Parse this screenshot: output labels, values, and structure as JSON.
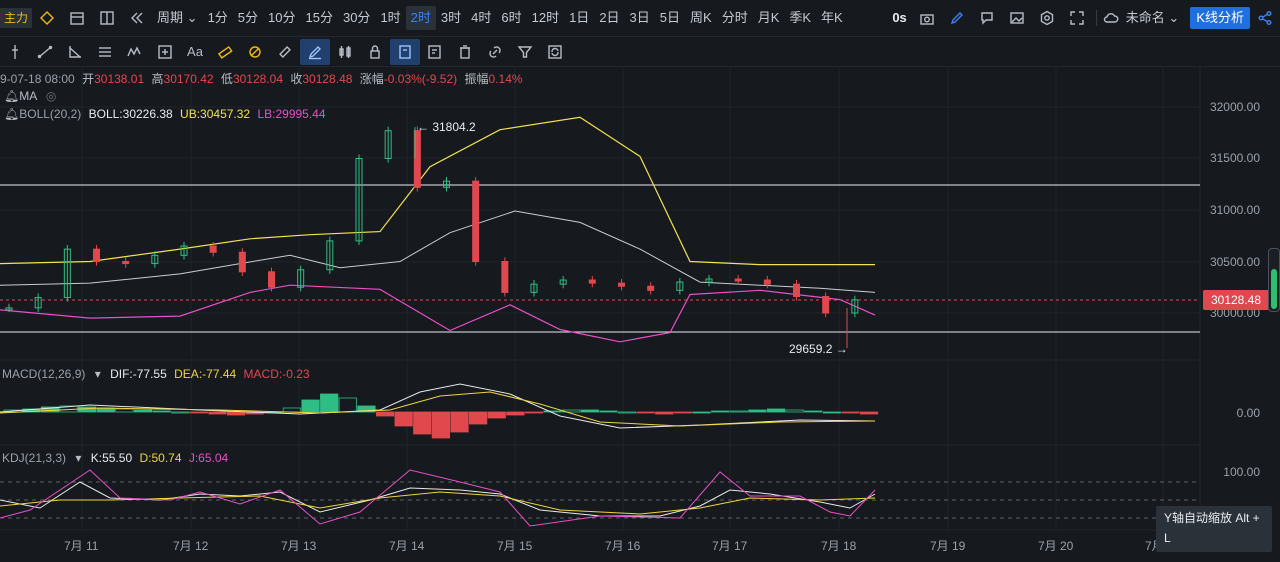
{
  "topbar": {
    "main_label": "主力",
    "period_label": "周期",
    "intervals": [
      "1分",
      "5分",
      "10分",
      "15分",
      "30分",
      "1时",
      "2时",
      "3时",
      "4时",
      "6时",
      "12时",
      "1日",
      "2日",
      "3日",
      "5日",
      "周K",
      "分时",
      "月K",
      "季K",
      "年K"
    ],
    "active_interval": "2时",
    "countdown": "0s",
    "account_name": "未命名",
    "analysis_button": "K线分析"
  },
  "ohlc": {
    "date": "9-07-18 08:00",
    "open_label": "开",
    "open": "30138.01",
    "high_label": "高",
    "high": "30170.42",
    "low_label": "低",
    "low": "30128.04",
    "close_label": "收",
    "close": "30128.48",
    "change_label": "涨幅",
    "change": "-0.03%(-9.52)",
    "amplitude_label": "振幅",
    "amplitude": "0.14%"
  },
  "indicators": {
    "ma_label": "MA",
    "boll_label": "BOLL(20,2)",
    "boll_mid": "BOLL:30226.38",
    "boll_ub": "UB:30457.32",
    "boll_lb": "LB:29995.44",
    "macd_label": "MACD(12,26,9)",
    "macd_dif": "DIF:-77.55",
    "macd_dea": "DEA:-77.44",
    "macd_val": "MACD:-0.23",
    "kdj_label": "KDJ(21,3,3)",
    "kdj_k": "K:55.50",
    "kdj_d": "D:50.74",
    "kdj_j": "J:65.04"
  },
  "annotations": {
    "high_marker": "← 31804.2",
    "low_marker": "29659.2 →"
  },
  "price_axis": [
    "32000.00",
    "31500.00",
    "31000.00",
    "30500.00",
    "30000.00"
  ],
  "current_price": "30128.48",
  "macd_axis": "0.00",
  "kdj_axis": "100.00",
  "date_axis": [
    "7月 11",
    "7月 12",
    "7月 13",
    "7月 14",
    "7月 15",
    "7月 16",
    "7月 17",
    "7月 18",
    "7月 19",
    "7月 20",
    "7月"
  ],
  "tooltip": {
    "line1": "Y轴自动缩放 Alt +",
    "line2": "L"
  },
  "colors": {
    "up": "#2ebd85",
    "down": "#e0484e",
    "boll_mid": "#c9ccd1",
    "boll_ub": "#f5e34a",
    "boll_lb": "#e84fc8",
    "dif": "#e8e8e8",
    "dea": "#f0d43a",
    "kdj_k": "#e8e8e8",
    "kdj_d": "#f0d43a",
    "kdj_j": "#e84fc8",
    "accent": "#1e6fe0"
  },
  "chart_data": {
    "type": "candlestick",
    "x_dates": [
      "7月 11",
      "7月 12",
      "7月 13",
      "7月 14",
      "7月 15",
      "7月 16",
      "7月 17",
      "7月 18"
    ],
    "ylim": [
      29500,
      32150
    ],
    "candles_approx_close": [
      30050,
      30150,
      30620,
      30500,
      30480,
      30560,
      30650,
      30590,
      30400,
      30250,
      30420,
      30700,
      31500,
      31770,
      31220,
      31280,
      30500,
      30200,
      30280,
      30320,
      30290,
      30260,
      30220,
      30300,
      30330,
      30320,
      30280,
      30160,
      30000,
      30128
    ],
    "high_point": 31804.2,
    "low_point": 29659.2,
    "horizontal_levels": [
      31250,
      29820
    ]
  }
}
